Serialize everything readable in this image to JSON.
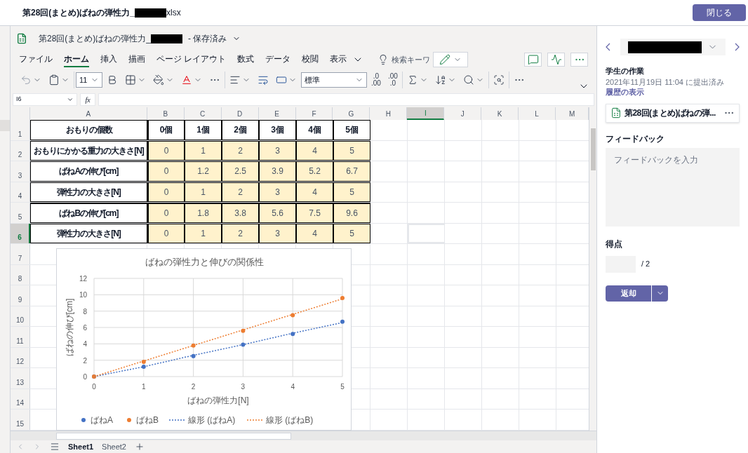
{
  "top_bar": {
    "title_prefix": "第28回(まとめ)ばねの弾性力_",
    "title_suffix": "xlsx",
    "close_button": "閉じる"
  },
  "excel": {
    "file_name": "第28回(まとめ)ばねの弾性力_",
    "save_status": "- 保存済み",
    "tabs": [
      {
        "label": "ファイル",
        "selected": false
      },
      {
        "label": "ホーム",
        "selected": true
      },
      {
        "label": "挿入",
        "selected": false
      },
      {
        "label": "描画",
        "selected": false
      },
      {
        "label": "ページ レイアウト",
        "selected": false
      },
      {
        "label": "数式",
        "selected": false
      },
      {
        "label": "データ",
        "selected": false
      },
      {
        "label": "校閲",
        "selected": false
      },
      {
        "label": "表示",
        "selected": false
      }
    ],
    "search_placeholder": "検索キーワ",
    "font_size": "11",
    "number_format": "標準",
    "decimal_buttons": [
      {
        "top": ".0",
        "bottom": ".00"
      },
      {
        "top": ".00",
        "bottom": ".0"
      }
    ],
    "name_box": "I6",
    "formula_icon": "fx",
    "columns": [
      {
        "label": "A",
        "selected": false
      },
      {
        "label": "B",
        "selected": false
      },
      {
        "label": "C",
        "selected": false
      },
      {
        "label": "D",
        "selected": false
      },
      {
        "label": "E",
        "selected": false
      },
      {
        "label": "F",
        "selected": false
      },
      {
        "label": "G",
        "selected": false
      },
      {
        "label": "H",
        "selected": false
      },
      {
        "label": "I",
        "selected": true
      },
      {
        "label": "J",
        "selected": false
      },
      {
        "label": "K",
        "selected": false
      },
      {
        "label": "L",
        "selected": false
      },
      {
        "label": "M",
        "selected": false
      }
    ],
    "rows": [
      {
        "label": "1",
        "selected": false
      },
      {
        "label": "2",
        "selected": false
      },
      {
        "label": "3",
        "selected": false
      },
      {
        "label": "4",
        "selected": false
      },
      {
        "label": "5",
        "selected": false
      },
      {
        "label": "6",
        "selected": true
      },
      {
        "label": "7",
        "selected": false
      },
      {
        "label": "8",
        "selected": false
      },
      {
        "label": "9",
        "selected": false
      },
      {
        "label": "10",
        "selected": false
      },
      {
        "label": "11",
        "selected": false
      },
      {
        "label": "12",
        "selected": false
      },
      {
        "label": "13",
        "selected": false
      },
      {
        "label": "14",
        "selected": false
      },
      {
        "label": "15",
        "selected": false
      }
    ],
    "table": [
      {
        "kind": "header",
        "group_start": false,
        "cells": [
          "おもりの個数",
          "0個",
          "1個",
          "2個",
          "3個",
          "4個",
          "5個"
        ]
      },
      {
        "kind": "value",
        "group_start": false,
        "cells": [
          "おもりにかかる重力の大きさ[N]",
          "0",
          "1",
          "2",
          "3",
          "4",
          "5"
        ]
      },
      {
        "kind": "value",
        "group_start": false,
        "cells": [
          "ばねAの伸び[cm]",
          "0",
          "1.2",
          "2.5",
          "3.9",
          "5.2",
          "6.7"
        ]
      },
      {
        "kind": "value",
        "group_start": false,
        "cells": [
          "弾性力の大きさ[N]",
          "0",
          "1",
          "2",
          "3",
          "4",
          "5"
        ]
      },
      {
        "kind": "value",
        "group_start": true,
        "cells": [
          "ばねBの伸び[cm]",
          "0",
          "1.8",
          "3.8",
          "5.6",
          "7.5",
          "9.6"
        ]
      },
      {
        "kind": "value",
        "group_start": false,
        "cells": [
          "弾性力の大きさ[N]",
          "0",
          "1",
          "2",
          "3",
          "4",
          "5"
        ]
      }
    ],
    "chart_data": {
      "type": "scatter",
      "title": "ばねの弾性力と伸びの関係性",
      "xlabel": "ばねの弾性力[N]",
      "ylabel": "ばねの伸び[cm]",
      "x": [
        0,
        1,
        2,
        3,
        4,
        5
      ],
      "xlim": [
        0,
        5
      ],
      "ylim": [
        0,
        12
      ],
      "xticks": [
        0,
        1,
        2,
        3,
        4,
        5
      ],
      "yticks": [
        0,
        2,
        4,
        6,
        8,
        10,
        12
      ],
      "grid": true,
      "legend": "bottom",
      "series": [
        {
          "name": "ばねA",
          "color": "#4472c4",
          "type": "scatter",
          "values": [
            0,
            1.2,
            2.5,
            3.9,
            5.2,
            6.7
          ]
        },
        {
          "name": "ばねB",
          "color": "#ed7d31",
          "type": "scatter",
          "values": [
            0,
            1.8,
            3.8,
            5.6,
            7.5,
            9.6
          ]
        },
        {
          "name": "線形 (ばねA)",
          "color": "#4472c4",
          "type": "line",
          "line_style": "dotted",
          "values": [
            0,
            1.2,
            2.6,
            3.9,
            5.3,
            6.6
          ]
        },
        {
          "name": "線形 (ばねB)",
          "color": "#ed7d31",
          "type": "line",
          "line_style": "dotted",
          "values": [
            0,
            1.9,
            3.8,
            5.7,
            7.6,
            9.5
          ]
        }
      ]
    },
    "sheets": [
      {
        "label": "Sheet1",
        "selected": true
      },
      {
        "label": "Sheet2",
        "selected": false
      }
    ]
  },
  "panel": {
    "section_title": "学生の作業",
    "submitted": "2021年11月19日 11:04 に提出済み",
    "history_link": "履歴の表示",
    "file_name": "第28回(まとめ)ばねの弾...",
    "feedback_label": "フィードバック",
    "feedback_placeholder": "フィードバックを入力",
    "score_label": "得点",
    "score_max": "/ 2",
    "return_button": "返却"
  }
}
